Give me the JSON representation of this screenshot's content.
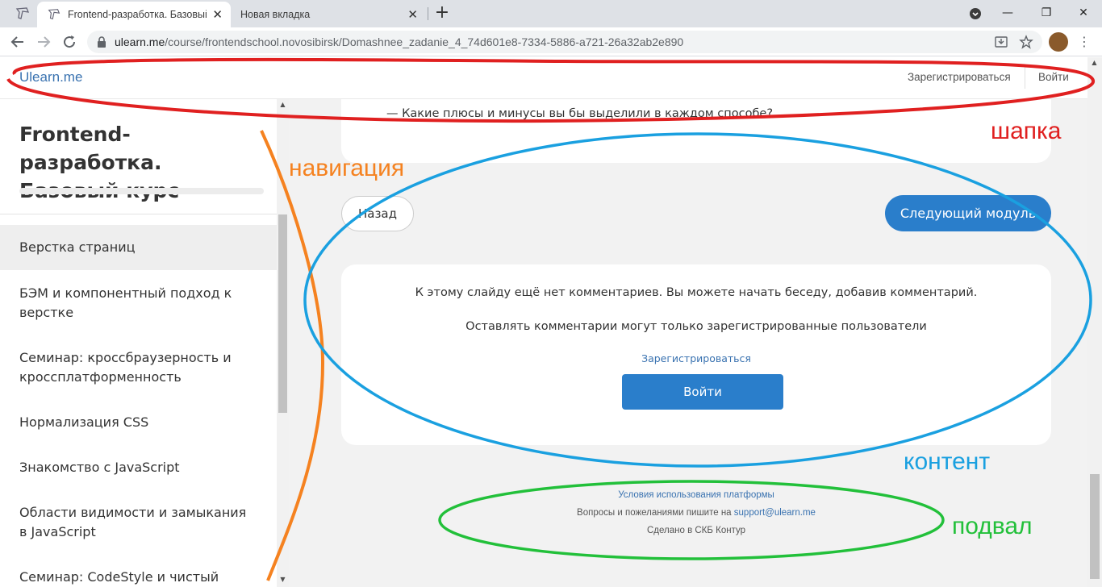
{
  "browser": {
    "tabs": [
      {
        "title": "Frontend-разработка. Базовый к",
        "close": "✕"
      },
      {
        "title": "Новая вкладка",
        "close": "✕"
      }
    ],
    "new_tab": "+",
    "window_controls": {
      "minimize": "—",
      "maximize": "❐",
      "close": "✕"
    },
    "url_host": "ulearn.me",
    "url_path": "/course/frontendschool.novosibirsk/Domashnee_zadanie_4_74d601e8-7334-5886-a721-26a32ab2e890",
    "menu": "⋮",
    "icons": [
      "back-icon",
      "forward-icon",
      "reload-icon",
      "lock-icon",
      "install-icon",
      "star-icon",
      "profile-avatar",
      "menu-icon"
    ]
  },
  "header": {
    "logo": "Ulearn.me",
    "register": "Зарегистрироваться",
    "login": "Войти"
  },
  "sidebar": {
    "course_title": "Frontend-разработка. Базовый курс",
    "items": [
      {
        "label": "Верстка страниц"
      },
      {
        "label": "БЭМ и компонентный подход к верстке"
      },
      {
        "label": "Семинар: кроссбраузерность и кроссплатформенность"
      },
      {
        "label": "Нормализация CSS"
      },
      {
        "label": "Знакомство с JavaScript"
      },
      {
        "label": "Области видимости и замыкания в JavaScript"
      },
      {
        "label": "Семинар: CodeStyle и чистый"
      }
    ]
  },
  "content": {
    "question": "—  Какие плюсы и минусы вы бы выделили в каждом способе?",
    "back_button": "Назад",
    "next_button": "Следующий модуль",
    "comments": {
      "no_comments": "К этому слайду ещё нет комментариев. Вы можете начать беседу, добавив комментарий.",
      "only_registered": "Оставлять комментарии могут только зарегистрированные пользователи",
      "register_link": "Зарегистрироваться",
      "login_button": "Войти"
    }
  },
  "footer": {
    "terms": "Условия использования платформы",
    "contact_prefix": "Вопросы и пожеланиями пишите на ",
    "contact_email": "support@ulearn.me",
    "made_by": "Сделано в СКБ Контур"
  },
  "annotations": {
    "header": {
      "label": "шапка",
      "color": "#e02020"
    },
    "navigation": {
      "label": "навигация",
      "color": "#f58220"
    },
    "content": {
      "label": "контент",
      "color": "#1aa0e0"
    },
    "footer": {
      "label": "подвал",
      "color": "#22c03a"
    }
  }
}
